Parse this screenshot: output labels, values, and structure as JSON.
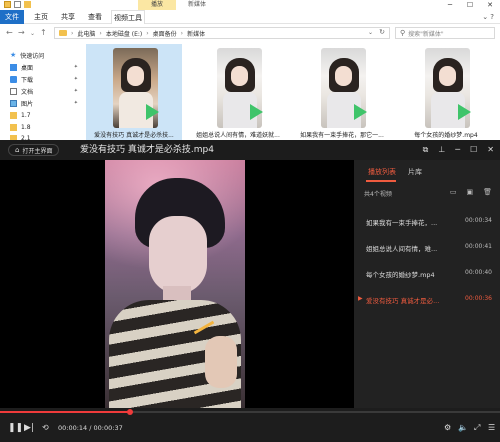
{
  "explorer": {
    "context_tab": "播放",
    "context_title": "新媒体",
    "ribbon_tabs": {
      "file": "文件",
      "home": "主页",
      "share": "共享",
      "view": "查看",
      "video_tools": "视频工具"
    },
    "breadcrumbs": [
      "此电脑",
      "本地磁盘 (E:)",
      "桌面备份",
      "新媒体"
    ],
    "search_placeholder": "搜索\"新媒体\"",
    "nav_items": [
      {
        "label": "快速访问",
        "icon": "star-icon"
      },
      {
        "label": "桌面",
        "icon": "desktop-icon"
      },
      {
        "label": "下载",
        "icon": "download-icon"
      },
      {
        "label": "文档",
        "icon": "document-icon"
      },
      {
        "label": "图片",
        "icon": "picture-icon"
      },
      {
        "label": "1.7",
        "icon": "folder-icon"
      },
      {
        "label": "1.8",
        "icon": "folder-icon"
      },
      {
        "label": "2.1",
        "icon": "folder-icon"
      }
    ],
    "files": [
      {
        "label": "爱没有技巧 真诚才是必杀技...",
        "selected": true
      },
      {
        "label": "姐姐总说人间有情，难道妖就...",
        "selected": false
      },
      {
        "label": "如果我有一束手捧花，那它一...",
        "selected": false
      },
      {
        "label": "每个女孩的婚纱梦.mp4",
        "selected": false
      }
    ]
  },
  "player": {
    "home_button": "打开主界面",
    "title": "爱没有技巧 真诚才是必杀技.mp4",
    "playlist_tabs": [
      "播放列表",
      "片库"
    ],
    "playlist_count": "共4个视频",
    "playlist": [
      {
        "name": "如果我有一束手捧花，...",
        "duration": "00:00:34",
        "playing": false
      },
      {
        "name": "姐姐总说人间有情，难...",
        "duration": "00:00:41",
        "playing": false
      },
      {
        "name": "每个女孩的婚纱梦.mp4",
        "duration": "00:00:40",
        "playing": false
      },
      {
        "name": "爱没有技巧 真诚才是必...",
        "duration": "00:00:36",
        "playing": true
      }
    ],
    "current_time": "00:00:14",
    "total_time": "00:00:37",
    "progress": 0.26,
    "accent_color": "#ef5b3f"
  }
}
